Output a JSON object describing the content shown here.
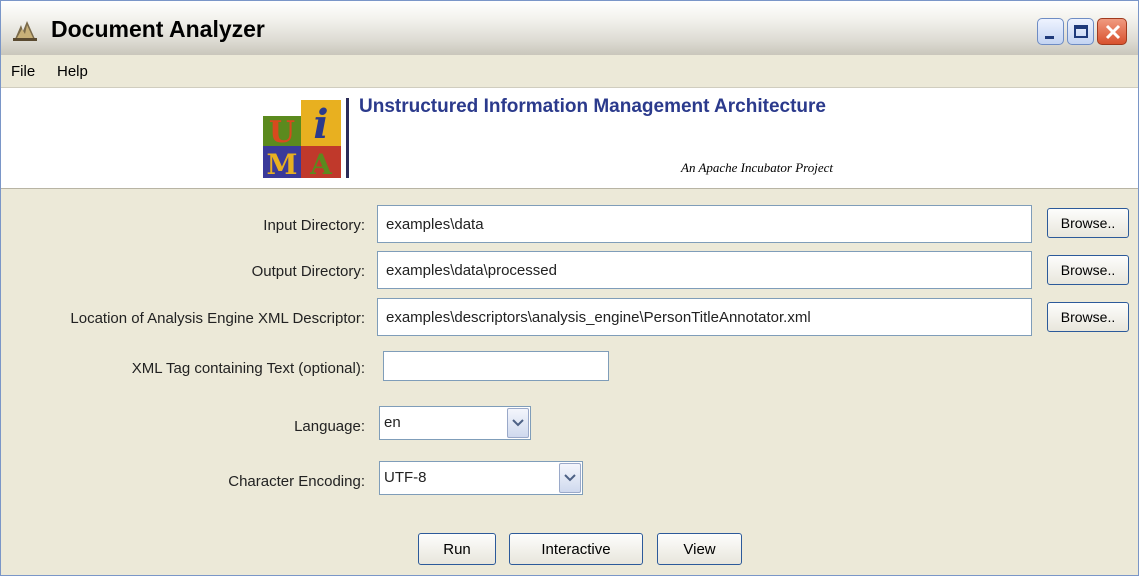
{
  "window": {
    "title": "Document Analyzer",
    "icon": "app-launch-icon"
  },
  "menu": [
    "File",
    "Help"
  ],
  "banner": {
    "title": "Unstructured Information Management Architecture",
    "subtitle": "An Apache Incubator Project",
    "logo_letters": [
      "U",
      "i",
      "M",
      "A"
    ],
    "logo_colors": {
      "U": "#5b8a1e",
      "i": "#e8b020",
      "M": "#3a3a9a",
      "A": "#c0392b"
    }
  },
  "form": {
    "input_directory": {
      "label": "Input Directory:",
      "value": "examples\\data",
      "browse": "Browse.."
    },
    "output_directory": {
      "label": "Output Directory:",
      "value": "examples\\data\\processed",
      "browse": "Browse.."
    },
    "descriptor": {
      "label": "Location of Analysis Engine XML Descriptor:",
      "value": "examples\\descriptors\\analysis_engine\\PersonTitleAnnotator.xml",
      "browse": "Browse.."
    },
    "xml_tag": {
      "label": "XML Tag containing Text (optional):",
      "value": ""
    },
    "language": {
      "label": "Language:",
      "value": "en"
    },
    "encoding": {
      "label": "Character Encoding:",
      "value": "UTF-8"
    }
  },
  "actions": {
    "run": "Run",
    "interactive": "Interactive",
    "view": "View"
  },
  "colors": {
    "banner_title": "#2b3a8c",
    "field_border": "#7f9db9",
    "panel_bg": "#ece9d8"
  }
}
